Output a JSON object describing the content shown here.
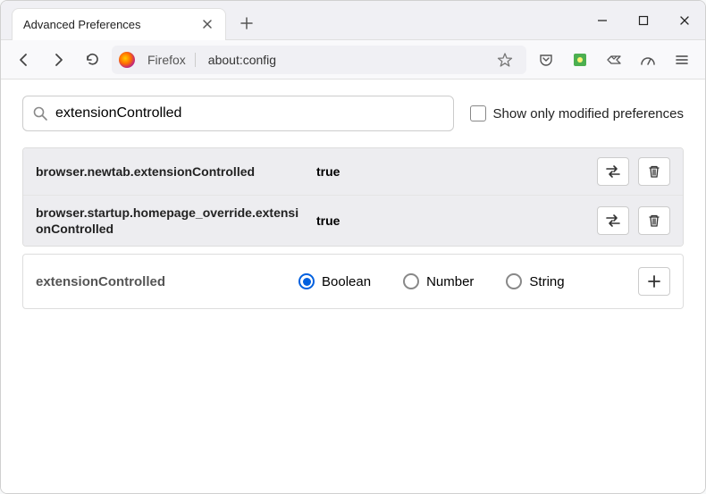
{
  "window": {
    "tab_title": "Advanced Preferences"
  },
  "urlbar": {
    "identity_label": "Firefox",
    "url": "about:config"
  },
  "config": {
    "search_value": "extensionControlled",
    "show_modified_label": "Show only modified preferences",
    "show_modified_checked": false,
    "prefs": [
      {
        "name": "browser.newtab.extensionControlled",
        "value": "true"
      },
      {
        "name": "browser.startup.homepage_override.extensionControlled",
        "value": "true"
      }
    ],
    "new_pref": {
      "name": "extensionControlled",
      "types": [
        "Boolean",
        "Number",
        "String"
      ],
      "selected": "Boolean"
    }
  }
}
